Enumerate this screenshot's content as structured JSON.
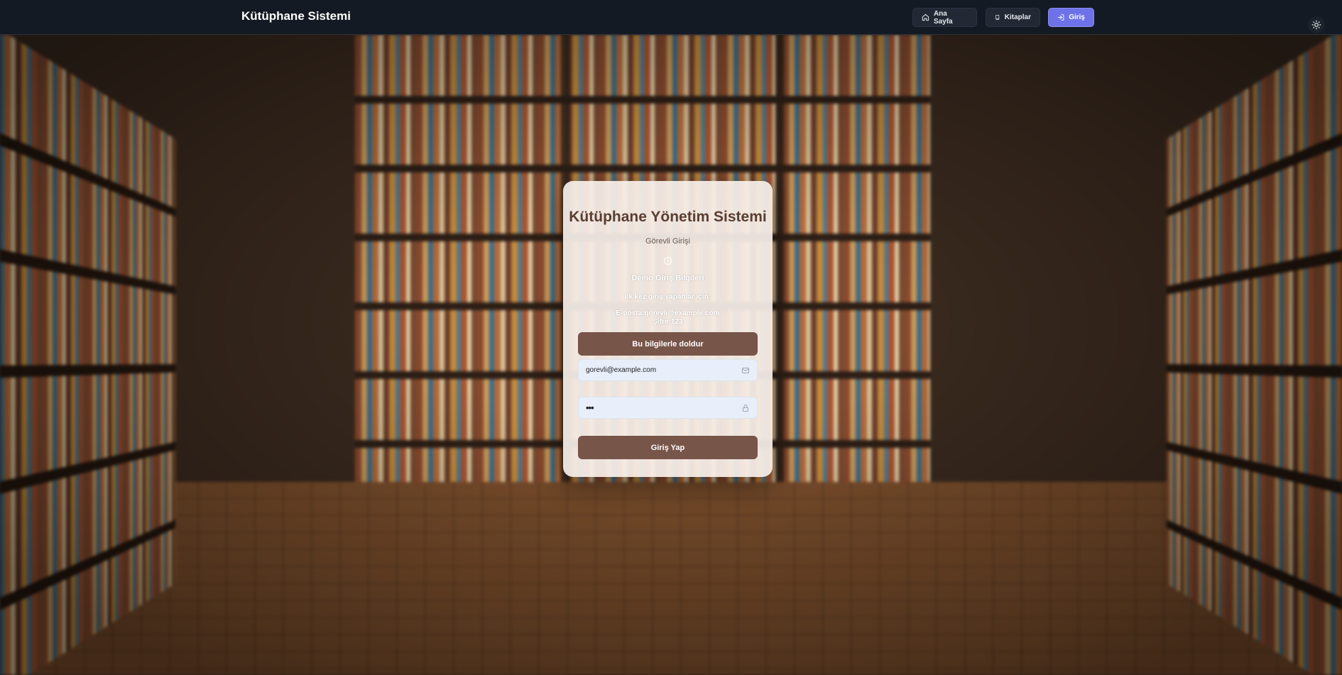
{
  "navbar": {
    "brand": "Kütüphane Sistemi",
    "home_label": "Ana Sayfa",
    "home_icon": "home-icon",
    "books_label": "Kitaplar",
    "books_icon": "book-icon",
    "login_label": "Giriş",
    "login_icon": "log-in-icon",
    "theme_icon": "sun-icon",
    "login_color": "#6d72e8"
  },
  "card": {
    "title": "Kütüphane Yönetim Sistemi",
    "subtitle": "Görevli Girişi",
    "info_icon": "info-icon",
    "demo_title": "Demo Giriş Bilgileri",
    "demo_first_login": "İlk kez giriş yapanlar için:",
    "demo_email": "E-posta:gorevli@example.com",
    "demo_password": "Şifre:123",
    "fill_button": "Bu bilgilerle doldur",
    "email_value": "gorevli@example.com",
    "email_icon": "mail-icon",
    "password_mask": "•••",
    "password_icon": "lock-icon",
    "submit_button": "Giriş Yap",
    "accent_color": "#775549"
  }
}
